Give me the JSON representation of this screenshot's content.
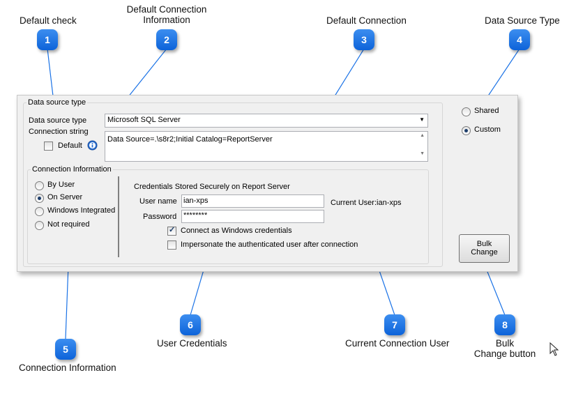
{
  "callouts": [
    {
      "num": "1",
      "label": "Default check"
    },
    {
      "num": "2",
      "label_line1": "Default Connection",
      "label_line2": "Information"
    },
    {
      "num": "3",
      "label": "Default Connection"
    },
    {
      "num": "4",
      "label": "Data Source Type"
    },
    {
      "num": "5",
      "label": "Connection Information"
    },
    {
      "num": "6",
      "label": "User Credentials"
    },
    {
      "num": "7",
      "label": "Current Connection User"
    },
    {
      "num": "8",
      "label_line1": "Bulk",
      "label_line2": "Change button"
    }
  ],
  "dialog": {
    "group_title": "Data source type",
    "ds_type_label": "Data source type",
    "ds_type_value": "Microsoft SQL Server",
    "conn_string_label": "Connection string",
    "default_label": "Default",
    "conn_string_value": "Data Source=.\\s8r2;Initial Catalog=ReportServer",
    "conn_info": {
      "title": "Connection Information",
      "options": [
        "By User",
        "On Server",
        "Windows Integrated",
        "Not required"
      ],
      "selected": "On Server"
    },
    "credentials": {
      "title": "Credentials Stored Securely on Report Server",
      "username_label": "User name",
      "username_value": "ian-xps",
      "password_label": "Password",
      "password_value": "********",
      "current_user": "Current User:ian-xps",
      "connect_windows": "Connect as Windows credentials",
      "connect_windows_checked": true,
      "impersonate": "Impersonate the authenticated user after connection",
      "impersonate_checked": false
    },
    "source_type": {
      "shared": "Shared",
      "custom": "Custom",
      "selected": "Custom"
    },
    "bulk_line1": "Bulk",
    "bulk_line2": "Change"
  },
  "colors": {
    "badge": "#1a72e6",
    "callout_line": "#1a72e6"
  }
}
